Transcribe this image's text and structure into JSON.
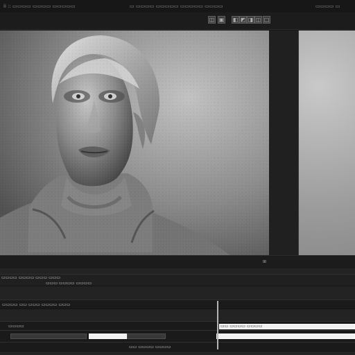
{
  "menu": {
    "left": "ii  ::  ▭▭▭▭  ▭▭▭▭ ▭▭▭▭▭",
    "center": "▭ ▭▭▭▭ ▭▭▭▭▭ ▭▭▭▭▭ ▭▭▭▭▭",
    "right": "▭▭▭▭  ▭"
  },
  "toolbar": {
    "icons": [
      "◫",
      "▣",
      "◧",
      "◩",
      "◨",
      "◫",
      "□"
    ]
  },
  "preview": {
    "subject": "woman-portrait"
  },
  "preview_footer": {
    "label_right": "⊞"
  },
  "timeline": {
    "labels": [
      "▭▭▭▭ ▭▭▭▭ ▭▭▭ ▭▭▭",
      "▭▭▭ ▭▭▭▭ ▭▭▭▭",
      "▭▭▭▭ ▭▭ ▭▭▭ ▭▭▭▭ ▭▭▭",
      "▭▭▭▭",
      "▭▭ ▭▭▭▭ ▭▭▭▭"
    ],
    "header_label": "▭▭ ▭▭▭▭ ▭▭▭▭"
  },
  "colors": {
    "panel_bg": "#151515",
    "preview_bg": "#6f6f6f",
    "timeline_bg": "#232323",
    "clip_light": "#f1f1f1"
  }
}
